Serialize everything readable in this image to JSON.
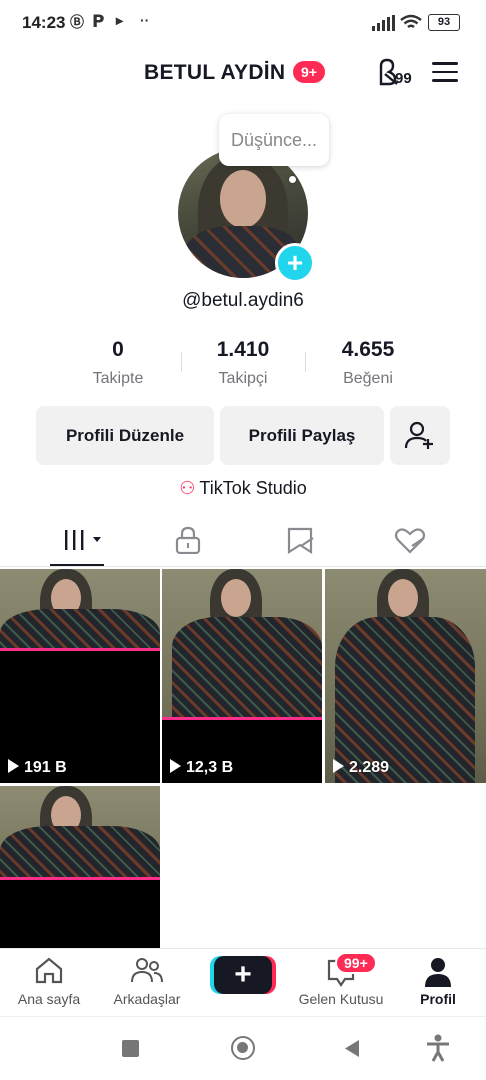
{
  "status_bar": {
    "time": "14:23",
    "battery": "93"
  },
  "header": {
    "username": "BETUL AYDİN",
    "notification_badge": "9+",
    "coin_label": "99"
  },
  "profile": {
    "thought_bubble": "Düşünce...",
    "handle": "@betul.aydin6",
    "stats": [
      {
        "value": "0",
        "label": "Takipte"
      },
      {
        "value": "1.410",
        "label": "Takipçi"
      },
      {
        "value": "4.655",
        "label": "Beğeni"
      }
    ],
    "edit_button": "Profili Düzenle",
    "share_button": "Profili Paylaş",
    "studio_link": "TikTok Studio"
  },
  "videos": [
    {
      "views": "191 B"
    },
    {
      "views": "12,3 B"
    },
    {
      "views": "2.289"
    },
    {
      "views": ""
    }
  ],
  "bottom_nav": {
    "home": "Ana sayfa",
    "friends": "Arkadaşlar",
    "create": "+",
    "inbox": "Gelen Kutusu",
    "inbox_badge": "99+",
    "profile": "Profil"
  },
  "colors": {
    "accent": "#fe2c55",
    "cyan": "#20d5ec",
    "text": "#161823"
  }
}
